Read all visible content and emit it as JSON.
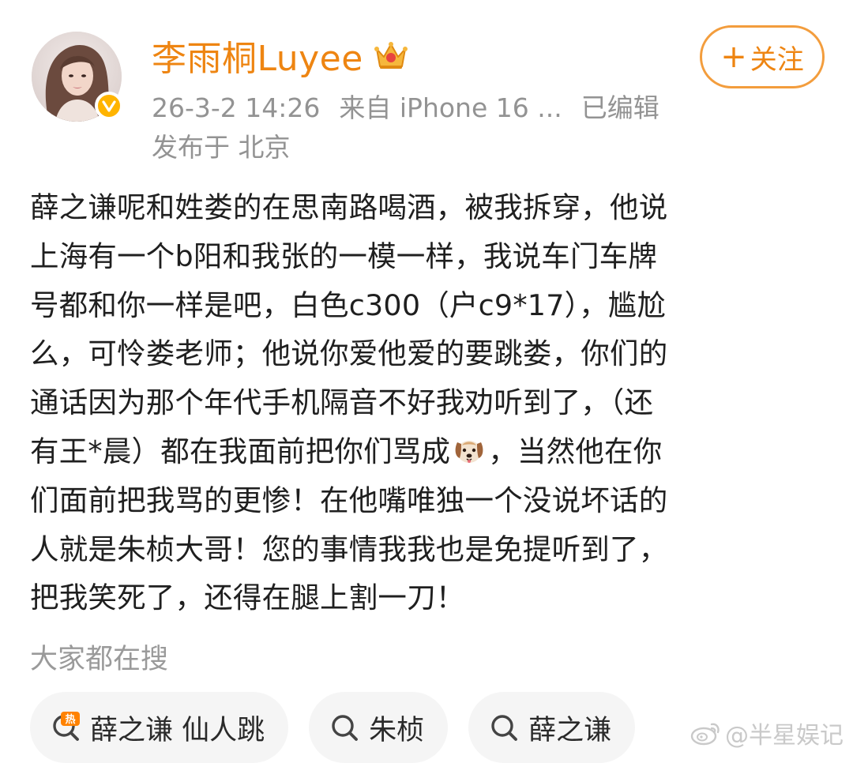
{
  "header": {
    "username": "李雨桐Luyee",
    "meta_line1_time": "26-3-2 14:26",
    "meta_line1_source": "来自 iPhone 16 ...",
    "meta_line1_edited": "已编辑",
    "meta_line2": "发布于 北京",
    "follow_label": "关注",
    "icons": {
      "verified": "verified-badge-icon",
      "crown": "crown-icon",
      "plus": "plus-icon"
    }
  },
  "post": {
    "lines": [
      "薛之谦呢和姓娄的在思南路喝酒，被我拆穿，他说",
      "上海有一个b阳和我张的一模一样，我说车门车牌",
      "号都和你一样是吧，白色c300（户c9*17），尴尬",
      "么，可怜娄老师；他说你爱他爱的要跳娄，你们的",
      "通话因为那个年代手机隔音不好我劝听到了，（还",
      "有王*晨）都在我面前把你们骂成",
      "，当然他在你",
      "们面前把我骂的更惨！在他嘴唯独一个没说坏话的",
      "人就是朱桢大哥！您的事情我我也是免提听到了，",
      "把我笑死了，还得在腿上割一刀！"
    ]
  },
  "trending": {
    "title": "大家都在搜",
    "chips": [
      {
        "label": "薛之谦 仙人跳",
        "icon": "hot-search-icon"
      },
      {
        "label": "朱桢",
        "icon": "search-icon"
      },
      {
        "label": "薛之谦",
        "icon": "search-icon"
      }
    ]
  },
  "watermark": {
    "text": "@半星娱记",
    "icon": "weibo-logo-icon"
  },
  "colors": {
    "accent": "#ee8512",
    "meta_gray": "#939393",
    "verified": "#ffb400"
  }
}
